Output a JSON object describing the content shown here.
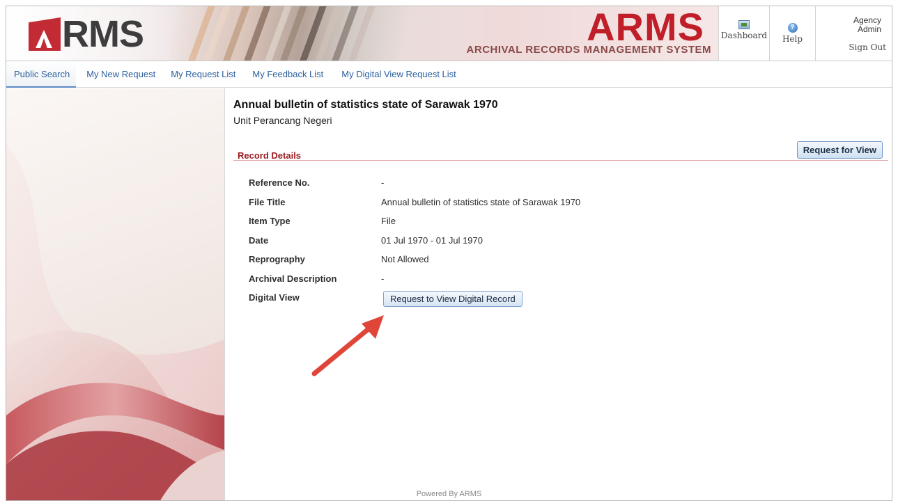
{
  "header": {
    "logo_text": "RMS",
    "brand_title": "ARMS",
    "brand_subtitle": "ARCHIVAL RECORDS MANAGEMENT SYSTEM",
    "dashboard_label": "Dashboard",
    "help_label": "Help",
    "help_icon_glyph": "?",
    "user_line1": "Agency",
    "user_line2": "Admin",
    "signout_label": "Sign Out"
  },
  "nav": {
    "items": [
      {
        "label": "Public Search",
        "active": true
      },
      {
        "label": "My New Request"
      },
      {
        "label": "My Request List"
      },
      {
        "label": "My Feedback List"
      },
      {
        "label": "My Digital View Request List"
      }
    ]
  },
  "record": {
    "title": "Annual bulletin of statistics state of Sarawak 1970",
    "agency": "Unit Perancang Negeri",
    "section_title": "Record Details",
    "request_view_label": "Request for View",
    "fields": [
      {
        "label": "Reference No.",
        "value": "-"
      },
      {
        "label": "File Title",
        "value": "Annual bulletin of statistics state of Sarawak 1970"
      },
      {
        "label": "Item Type",
        "value": "File"
      },
      {
        "label": "Date",
        "value": "01 Jul 1970 - 01 Jul 1970"
      },
      {
        "label": "Reprography",
        "value": "Not Allowed"
      },
      {
        "label": "Archival Description",
        "value": "-"
      },
      {
        "label": "Digital View",
        "value": ""
      }
    ],
    "digital_view_button": "Request to View Digital Record"
  },
  "footer": {
    "text": "Powered By ARMS"
  },
  "colors": {
    "brand_red": "#c01f2a",
    "section_red": "#9b1c22",
    "link_blue": "#2a5f9e",
    "arrow_red": "#e0453a"
  }
}
